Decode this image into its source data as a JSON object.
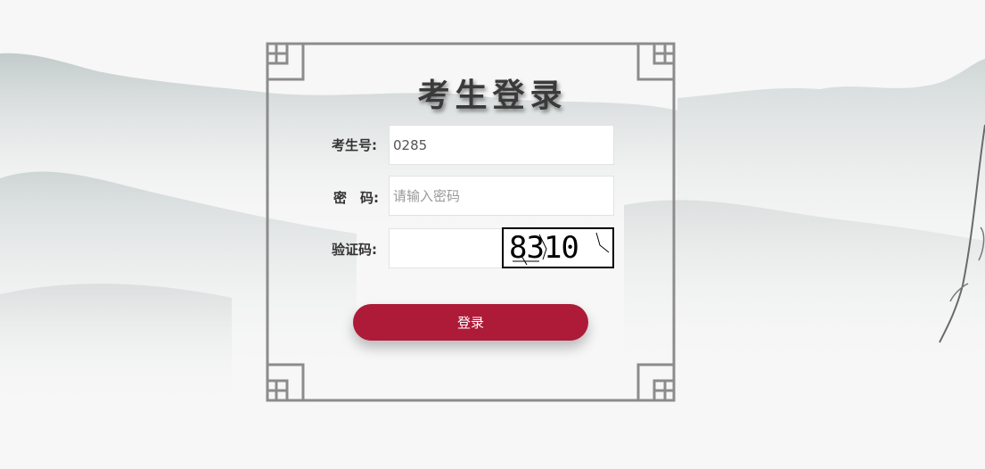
{
  "title": "考生登录",
  "fields": {
    "exam_no": {
      "label": "考生号:",
      "value": "0285"
    },
    "password": {
      "label": "密　码:",
      "placeholder": "请输入密码"
    },
    "captcha": {
      "label": "验证码:",
      "value": ""
    }
  },
  "captcha_image": {
    "text": "8310"
  },
  "login_button": {
    "label": "登录"
  },
  "colors": {
    "accent": "#ad1b38",
    "frame": "#8c8c8c",
    "title": "#3a3a3a"
  }
}
